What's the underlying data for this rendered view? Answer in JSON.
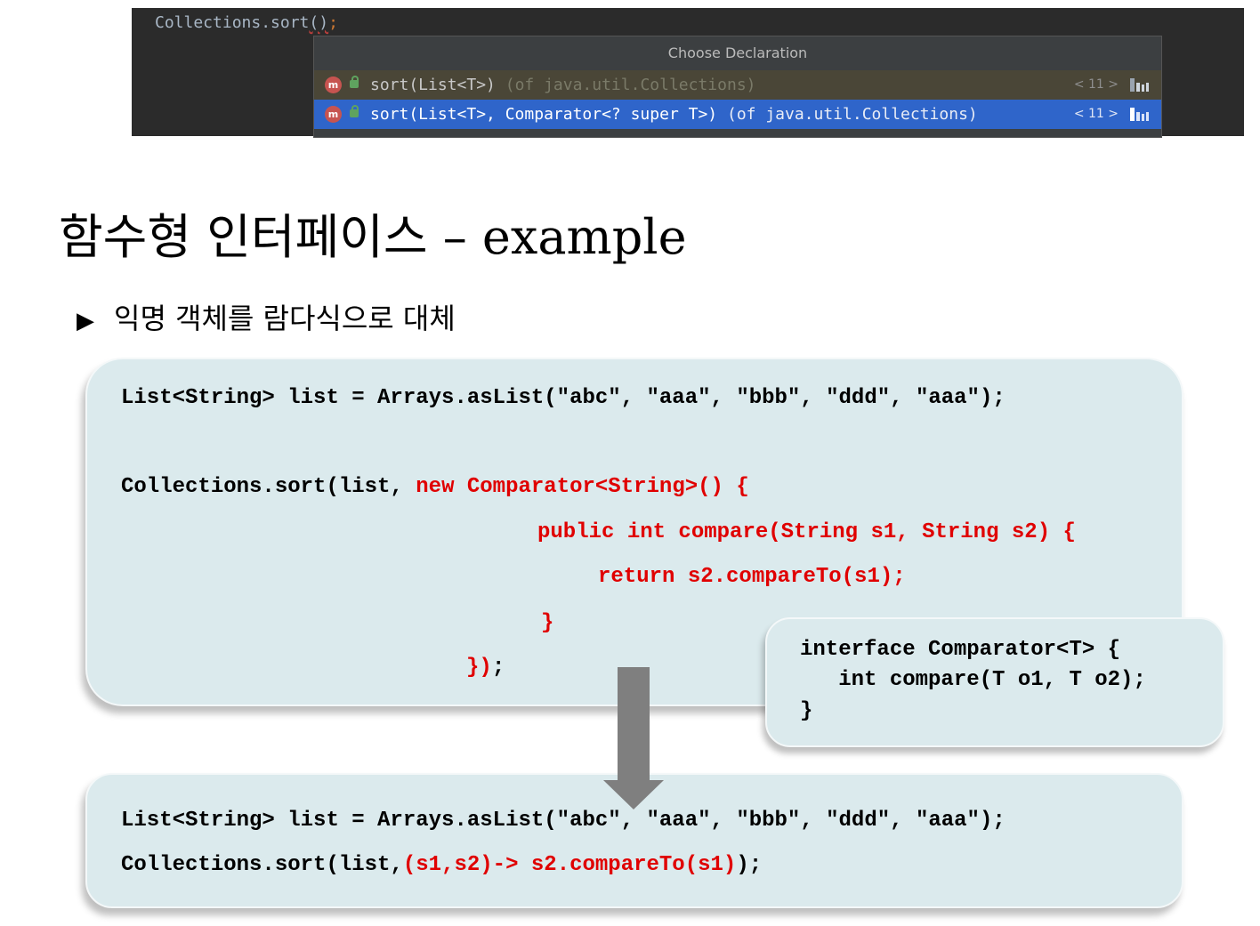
{
  "ide": {
    "code_prefix": "Collections.",
    "code_method": "sort",
    "code_parens": "()",
    "code_semicolon": ";",
    "popup_title": "Choose Declaration",
    "rows": [
      {
        "icon": "m",
        "signature": "sort(List<T>)",
        "package": " (of java.util.Collections)",
        "jdk": "< 11 >"
      },
      {
        "icon": "m",
        "signature": "sort(List<T>, Comparator<? super T>)",
        "package": " (of java.util.Collections)",
        "jdk": "< 11 >"
      }
    ]
  },
  "slide": {
    "title": "함수형 인터페이스 – example",
    "bullet_mark": "▶",
    "bullet_text": "익명 객체를 람다식으로 대체"
  },
  "box1": {
    "line1": "List<String> list = Arrays.asList(\"abc\", \"aaa\", \"bbb\", \"ddd\", \"aaa\");",
    "line2_black": "Collections.sort(list, ",
    "line2_red": "new Comparator<String>() {",
    "line3": "public int compare(String s1, String s2) {",
    "line4": "return s2.compareTo(s1);",
    "line5": "}",
    "line6_red": "})",
    "line6_black": ";"
  },
  "box3": {
    "line1": "interface Comparator<T> {",
    "line2": "   int compare(T o1, T o2);",
    "line3": "}"
  },
  "box2": {
    "line1": "List<String> list = Arrays.asList(\"abc\", \"aaa\", \"bbb\", \"ddd\", \"aaa\");",
    "line2_black": "Collections.sort(list,",
    "line2_red": "(s1,s2)-> s2.compareTo(s1)",
    "line2_end": ");"
  },
  "colors": {
    "code_red": "#e00000",
    "box_fill": "#dbeaed",
    "ide_bg": "#2b2b2b",
    "ide_selected": "#2f65ca",
    "arrow": "#7f7f7f"
  }
}
